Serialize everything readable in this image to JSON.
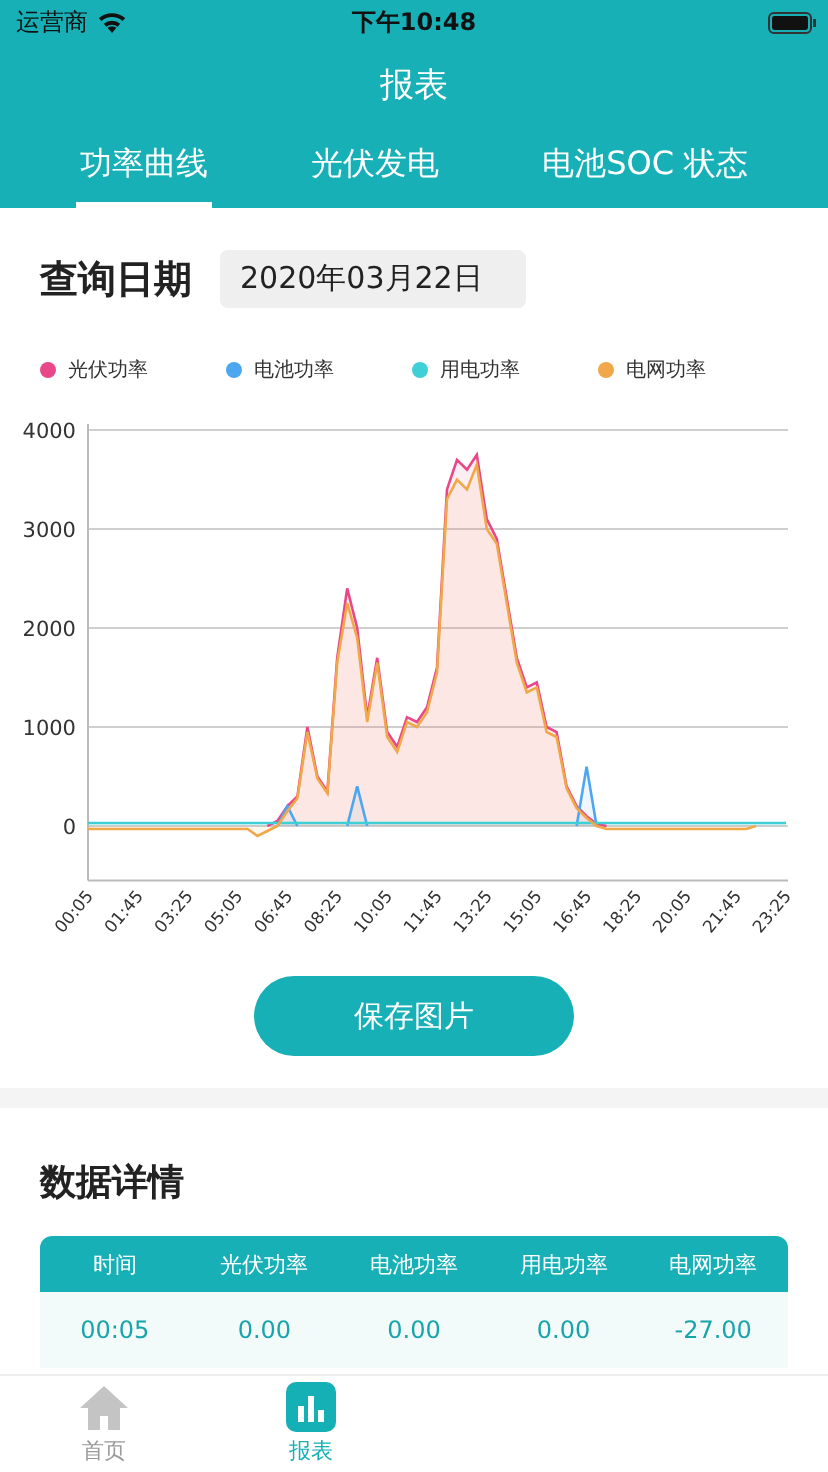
{
  "status_bar": {
    "carrier": "运营商",
    "time": "下午10:48"
  },
  "header": {
    "title": "报表"
  },
  "tabs": [
    {
      "label": "功率曲线",
      "selected": true
    },
    {
      "label": "光伏发电",
      "selected": false
    },
    {
      "label": "电池SOC 状态",
      "selected": false
    }
  ],
  "query": {
    "label": "查询日期",
    "value": "2020年03月22日"
  },
  "chart_data": {
    "type": "area",
    "stacked": false,
    "grid": true,
    "x": [
      5,
      25,
      45,
      65,
      85,
      105,
      125,
      145,
      165,
      185,
      205,
      225,
      245,
      265,
      285,
      305,
      325,
      345,
      365,
      385,
      405,
      425,
      445,
      465,
      485,
      505,
      525,
      545,
      565,
      585,
      605,
      625,
      645,
      665,
      685,
      705,
      725,
      745,
      765,
      785,
      805,
      825,
      845,
      865,
      885,
      905,
      925,
      945,
      965,
      985,
      1005,
      1025,
      1045,
      1065,
      1085,
      1105,
      1125,
      1145,
      1165,
      1185,
      1205,
      1225,
      1245,
      1265,
      1285,
      1305,
      1325,
      1345,
      1365,
      1385,
      1405
    ],
    "xlim": [
      5,
      1405
    ],
    "ylim": [
      -550,
      4000
    ],
    "yticks": [
      0,
      1000,
      2000,
      3000,
      4000
    ],
    "xticks": [
      {
        "value": 5,
        "label": "00:05"
      },
      {
        "value": 105,
        "label": "01:45"
      },
      {
        "value": 205,
        "label": "03:25"
      },
      {
        "value": 305,
        "label": "05:05"
      },
      {
        "value": 405,
        "label": "06:45"
      },
      {
        "value": 505,
        "label": "08:25"
      },
      {
        "value": 605,
        "label": "10:05"
      },
      {
        "value": 705,
        "label": "11:45"
      },
      {
        "value": 805,
        "label": "13:25"
      },
      {
        "value": 905,
        "label": "15:05"
      },
      {
        "value": 1005,
        "label": "16:45"
      },
      {
        "value": 1105,
        "label": "18:25"
      },
      {
        "value": 1205,
        "label": "20:05"
      },
      {
        "value": 1305,
        "label": "21:45"
      },
      {
        "value": 1405,
        "label": "23:25"
      }
    ],
    "series": [
      {
        "name": "光伏功率",
        "color": "#e8488a",
        "values": [
          null,
          null,
          null,
          null,
          null,
          null,
          null,
          null,
          null,
          null,
          null,
          null,
          null,
          null,
          null,
          null,
          null,
          null,
          0,
          50,
          200,
          300,
          1000,
          500,
          350,
          1700,
          2400,
          2000,
          1100,
          1700,
          950,
          800,
          1100,
          1050,
          1200,
          1600,
          3400,
          3700,
          3600,
          3750,
          3100,
          2900,
          2300,
          1700,
          1400,
          1450,
          1000,
          950,
          400,
          200,
          100,
          20,
          0,
          null,
          null,
          null,
          null,
          null,
          null,
          null,
          null,
          null,
          null,
          null,
          null,
          null,
          null,
          null,
          null,
          null,
          null
        ]
      },
      {
        "name": "电池功率",
        "color": "#4da6f0",
        "values": [
          null,
          null,
          null,
          null,
          null,
          null,
          null,
          null,
          null,
          null,
          null,
          null,
          null,
          null,
          null,
          null,
          null,
          null,
          null,
          0,
          200,
          0,
          null,
          null,
          null,
          null,
          0,
          400,
          0,
          null,
          null,
          null,
          null,
          null,
          null,
          null,
          null,
          null,
          null,
          null,
          null,
          null,
          null,
          null,
          null,
          null,
          null,
          null,
          null,
          0,
          600,
          0,
          null,
          null,
          null,
          null,
          null,
          null,
          null,
          null,
          null,
          null,
          null,
          null,
          null,
          null,
          null,
          null,
          null,
          null,
          null
        ]
      },
      {
        "name": "用电功率",
        "color": "#3fcfd6",
        "values": [
          30,
          30,
          30,
          30,
          30,
          30,
          30,
          30,
          30,
          30,
          30,
          30,
          30,
          30,
          30,
          30,
          30,
          30,
          30,
          30,
          30,
          30,
          30,
          30,
          30,
          30,
          30,
          30,
          30,
          30,
          30,
          30,
          30,
          30,
          30,
          30,
          30,
          30,
          30,
          30,
          30,
          30,
          30,
          30,
          30,
          30,
          30,
          30,
          30,
          30,
          30,
          30,
          30,
          30,
          30,
          30,
          30,
          30,
          30,
          30,
          30,
          30,
          30,
          30,
          30,
          30,
          30,
          30,
          30,
          30,
          30
        ]
      },
      {
        "name": "电网功率",
        "color": "#f0a848",
        "values": [
          -30,
          -30,
          -30,
          -30,
          -30,
          -30,
          -30,
          -30,
          -30,
          -30,
          -30,
          -30,
          -30,
          -30,
          -30,
          -30,
          -30,
          -100,
          -50,
          0,
          150,
          280,
          950,
          480,
          330,
          1650,
          2250,
          1900,
          1050,
          1650,
          900,
          750,
          1050,
          1000,
          1150,
          1550,
          3300,
          3500,
          3400,
          3650,
          3000,
          2850,
          2250,
          1650,
          1350,
          1400,
          950,
          900,
          380,
          180,
          80,
          0,
          -30,
          -30,
          -30,
          -30,
          -30,
          -30,
          -30,
          -30,
          -30,
          -30,
          -30,
          -30,
          -30,
          -30,
          -30,
          0,
          null,
          null,
          null
        ]
      }
    ]
  },
  "save_button": "保存图片",
  "details": {
    "title": "数据详情",
    "columns": [
      "时间",
      "光伏功率",
      "电池功率",
      "用电功率",
      "电网功率"
    ],
    "rows": [
      [
        "00:05",
        "0.00",
        "0.00",
        "0.00",
        "-27.00"
      ]
    ]
  },
  "tab_bar": [
    {
      "label": "首页",
      "selected": false
    },
    {
      "label": "报表",
      "selected": true
    }
  ]
}
